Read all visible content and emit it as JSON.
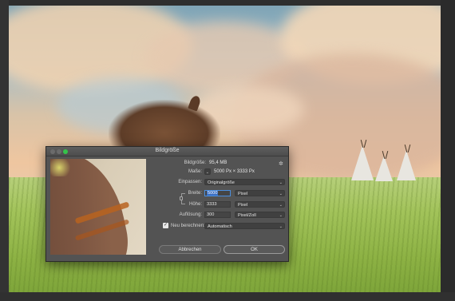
{
  "dialog": {
    "title": "Bildgröße",
    "image_size_label": "Bildgröße:",
    "image_size_value": "95,4 MB",
    "dimensions_label": "Maße:",
    "dimensions_value": "5000 Px  ×  3333 Px",
    "fit_label": "Einpassen:",
    "fit_value": "Originalgröße",
    "width_label": "Breite:",
    "width_value": "5000",
    "width_unit": "Pixel",
    "height_label": "Höhe:",
    "height_value": "3333",
    "height_unit": "Pixel",
    "resolution_label": "Auflösung:",
    "resolution_value": "300",
    "resolution_unit": "Pixel/Zoll",
    "resample_checked": "✓",
    "resample_label": "Neu berechnen:",
    "resample_value": "Automatisch",
    "cancel_label": "Abbrechen",
    "ok_label": "OK",
    "chevron": "⌄",
    "gear": "✲"
  },
  "icons": [
    "close-icon",
    "minimize-icon",
    "maximize-icon",
    "gear-icon",
    "chain-link-icon",
    "chevron-down-icon",
    "checkbox-icon"
  ],
  "colors": {
    "maximize": "#35c34a",
    "active_field": "#4a8fe0",
    "dialog_bg": "#535353"
  }
}
